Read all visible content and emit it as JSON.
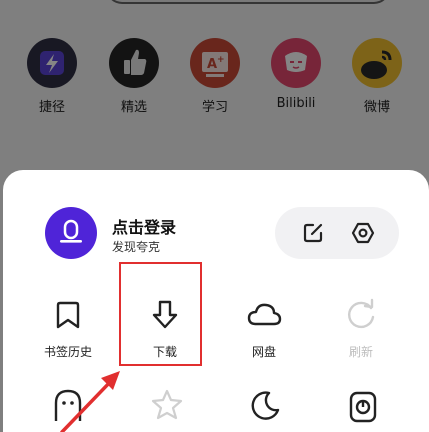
{
  "shortcuts": [
    {
      "label": "捷径",
      "icon": "shortcut-lightning-icon",
      "color": "#3a2c8a"
    },
    {
      "label": "精选",
      "icon": "thumbs-up-icon",
      "color": "#2a2a2a"
    },
    {
      "label": "学习",
      "icon": "study-board-icon",
      "color": "#d33c2d"
    },
    {
      "label": "Bilibili",
      "icon": "bilibili-tv-icon",
      "color": "#e8476e"
    },
    {
      "label": "微博",
      "icon": "weibo-icon",
      "color": "#f2c233"
    }
  ],
  "user": {
    "name": "点击登录",
    "subtitle": "发现夸克",
    "avatar_color": "#4f24d8"
  },
  "pill": {
    "left_icon": "share-edit-icon",
    "right_icon": "settings-hexagon-icon"
  },
  "grid": [
    {
      "label": "书签历史",
      "icon": "bookmark-icon",
      "disabled": false
    },
    {
      "label": "下载",
      "icon": "download-arrow-icon",
      "disabled": false
    },
    {
      "label": "网盘",
      "icon": "cloud-icon",
      "disabled": false
    },
    {
      "label": "刷新",
      "icon": "refresh-icon",
      "disabled": true
    },
    {
      "icon": "ghost-icon"
    },
    {
      "icon": "star-icon"
    },
    {
      "icon": "moon-icon"
    },
    {
      "icon": "capture-icon"
    }
  ],
  "annotation": {
    "highlight_color": "#e12f2f"
  }
}
